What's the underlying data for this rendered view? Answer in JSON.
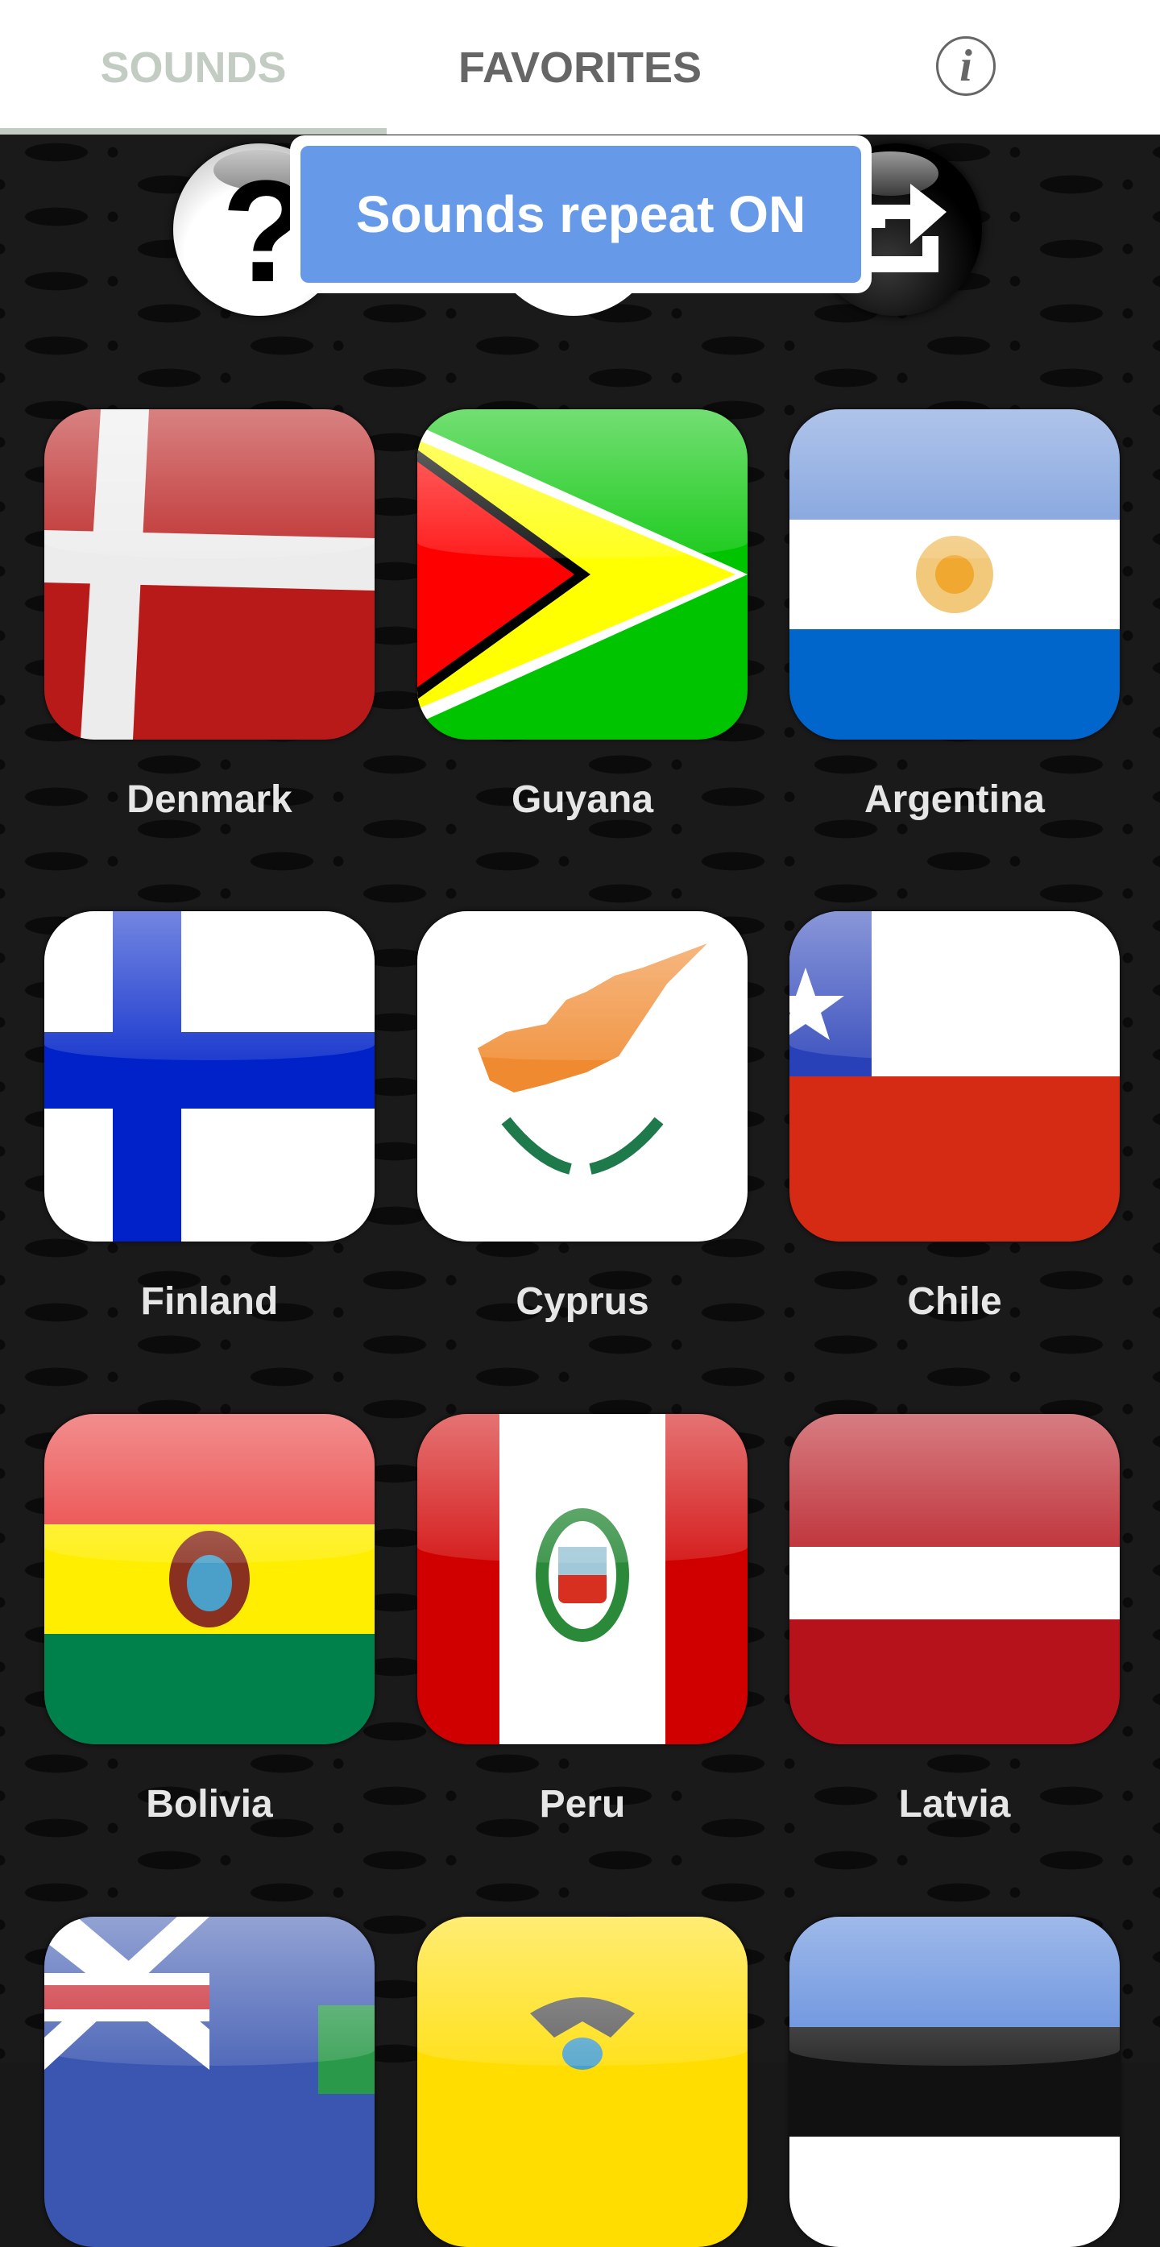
{
  "header": {
    "tabs": [
      {
        "label": "SOUNDS",
        "active": true
      },
      {
        "label": "FAVORITES",
        "active": false
      }
    ],
    "info_icon": "info-icon",
    "info_glyph": "i"
  },
  "toolbar": {
    "help_icon": "question-mark-icon",
    "help_glyph": "?",
    "middle_icon": "repeat-toggle-icon",
    "share_icon": "share-icon"
  },
  "toast": {
    "message": "Sounds repeat ON"
  },
  "colors": {
    "tab_active": "#c2ccc2",
    "tab_inactive": "#666666",
    "toast_bg": "#6699e8",
    "label_text": "#e6e6e6",
    "background": "#1a1a1a"
  },
  "grid": {
    "items": [
      {
        "label": "Denmark",
        "flag": "denmark-flag-icon"
      },
      {
        "label": "Guyana",
        "flag": "guyana-flag-icon"
      },
      {
        "label": "Argentina",
        "flag": "argentina-flag-icon"
      },
      {
        "label": "Finland",
        "flag": "finland-flag-icon"
      },
      {
        "label": "Cyprus",
        "flag": "cyprus-flag-icon"
      },
      {
        "label": "Chile",
        "flag": "chile-flag-icon"
      },
      {
        "label": "Bolivia",
        "flag": "bolivia-flag-icon"
      },
      {
        "label": "Peru",
        "flag": "peru-flag-icon"
      },
      {
        "label": "Latvia",
        "flag": "latvia-flag-icon"
      },
      {
        "label": "",
        "flag": "montserrat-flag-icon"
      },
      {
        "label": "",
        "flag": "ecuador-flag-icon"
      },
      {
        "label": "",
        "flag": "estonia-flag-icon"
      }
    ]
  }
}
